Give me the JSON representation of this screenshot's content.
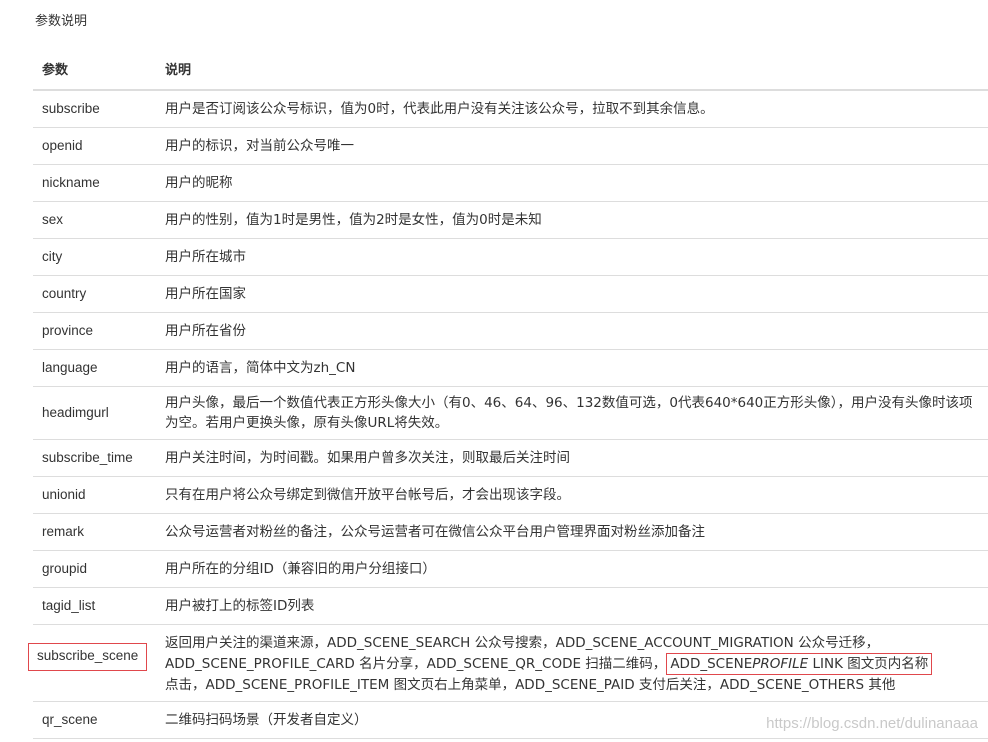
{
  "section_title": "参数说明",
  "headers": {
    "param": "参数",
    "desc": "说明"
  },
  "rows": [
    {
      "name": "subscribe",
      "desc": "用户是否订阅该公众号标识，值为0时，代表此用户没有关注该公众号，拉取不到其余信息。"
    },
    {
      "name": "openid",
      "desc": "用户的标识，对当前公众号唯一"
    },
    {
      "name": "nickname",
      "desc": "用户的昵称"
    },
    {
      "name": "sex",
      "desc": "用户的性别，值为1时是男性，值为2时是女性，值为0时是未知"
    },
    {
      "name": "city",
      "desc": "用户所在城市"
    },
    {
      "name": "country",
      "desc": "用户所在国家"
    },
    {
      "name": "province",
      "desc": "用户所在省份"
    },
    {
      "name": "language",
      "desc": "用户的语言，简体中文为zh_CN"
    },
    {
      "name": "headimgurl",
      "desc": "用户头像，最后一个数值代表正方形头像大小（有0、46、64、96、132数值可选，0代表640*640正方形头像），用户没有头像时该项为空。若用户更换头像，原有头像URL将失效。"
    },
    {
      "name": "subscribe_time",
      "desc": "用户关注时间，为时间戳。如果用户曾多次关注，则取最后关注时间"
    },
    {
      "name": "unionid",
      "desc": "只有在用户将公众号绑定到微信开放平台帐号后，才会出现该字段。"
    },
    {
      "name": "remark",
      "desc": "公众号运营者对粉丝的备注，公众号运营者可在微信公众平台用户管理界面对粉丝添加备注"
    },
    {
      "name": "groupid",
      "desc": "用户所在的分组ID（兼容旧的用户分组接口）"
    },
    {
      "name": "tagid_list",
      "desc": "用户被打上的标签ID列表"
    }
  ],
  "scene_row": {
    "name": "subscribe_scene",
    "desc_part1": "返回用户关注的渠道来源，ADD_SCENE_SEARCH 公众号搜索，ADD_SCENE_ACCOUNT_MIGRATION 公众号迁移，ADD_SCENE_PROFILE_CARD 名片分享，ADD_SCENE_QR_CODE 扫描二维码，",
    "hl_prefix": "ADD_SCENE",
    "hl_italic": "PROFILE",
    "hl_suffix": " LINK 图文页内名称",
    "desc_part2": "点击，ADD_SCENE_PROFILE_ITEM 图文页右上角菜单，ADD_SCENE_PAID 支付后关注，ADD_SCENE_OTHERS 其他"
  },
  "last_row": {
    "name": "qr_scene",
    "desc": "二维码扫码场景（开发者自定义）"
  },
  "watermark": "https://blog.csdn.net/dulinanaaa",
  "colors": {
    "highlight_border": "#e0474c",
    "row_border": "#dddddd",
    "text": "#333333"
  }
}
